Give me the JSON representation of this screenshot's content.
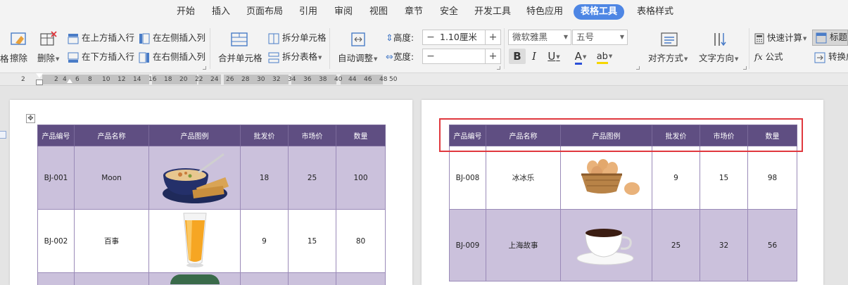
{
  "menu": {
    "tabs": [
      "开始",
      "插入",
      "页面布局",
      "引用",
      "审阅",
      "视图",
      "章节",
      "安全",
      "开发工具",
      "特色应用",
      "表格工具",
      "表格样式"
    ],
    "active_index": 10
  },
  "ribbon": {
    "erase": "擦除",
    "delete": "删除",
    "insert_above": "在上方插入行",
    "insert_below": "在下方插入行",
    "insert_left": "在左侧插入列",
    "insert_right": "在右侧插入列",
    "merge_cells": "合并单元格",
    "split_cells": "拆分单元格",
    "split_table": "拆分表格",
    "auto_fit": "自动调整",
    "height_label": "高度:",
    "height_value": "1.10厘米",
    "width_label": "宽度:",
    "width_value": "",
    "font_name": "微软雅黑",
    "font_size": "五号",
    "align": "对齐方式",
    "text_direction": "文字方向",
    "quick_calc": "快速计算",
    "formula": "公式",
    "title_row": "标题行",
    "convert": "转换成"
  },
  "ruler": {
    "numbers": [
      "2",
      "2",
      "4",
      "6",
      "8",
      "10",
      "12",
      "14",
      "16",
      "18",
      "20",
      "22",
      "24",
      "26",
      "28",
      "30",
      "32",
      "34",
      "36",
      "38",
      "40",
      "44",
      "46",
      "48",
      "50"
    ]
  },
  "table": {
    "headers": [
      "产品编号",
      "产品名称",
      "产品图例",
      "批发价",
      "市场价",
      "数量"
    ],
    "page1_rows": [
      {
        "id": "BJ-001",
        "name": "Moon",
        "image": "soup-bowl",
        "wholesale": "18",
        "market": "25",
        "qty": "100"
      },
      {
        "id": "BJ-002",
        "name": "百事",
        "image": "juice-glass",
        "wholesale": "9",
        "market": "15",
        "qty": "80"
      }
    ],
    "page2_rows": [
      {
        "id": "BJ-008",
        "name": "冰冰乐",
        "image": "egg-basket",
        "wholesale": "9",
        "market": "15",
        "qty": "98"
      },
      {
        "id": "BJ-009",
        "name": "上海故事",
        "image": "coffee-cup",
        "wholesale": "25",
        "market": "32",
        "qty": "56"
      }
    ]
  },
  "colors": {
    "accent_tab": "#4e86e4",
    "header_bg": "#5f4e82",
    "row_band": "#cbc1dc",
    "highlight": "#e0383e"
  }
}
